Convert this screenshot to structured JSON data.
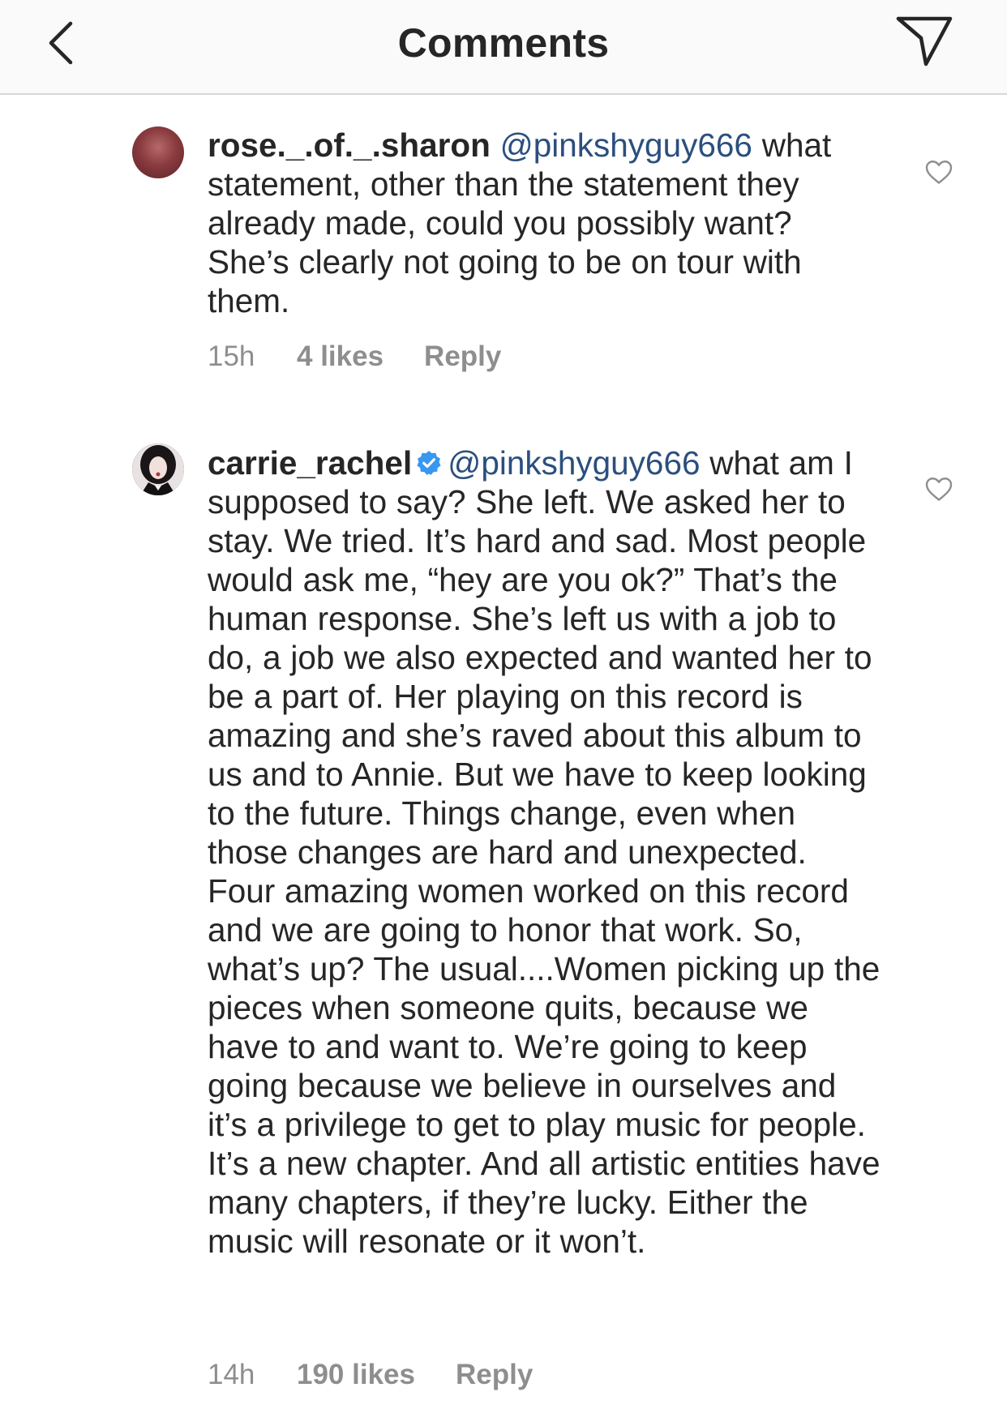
{
  "header": {
    "title": "Comments",
    "back_icon": "chevron-left-icon",
    "send_icon": "send-paper-plane-icon"
  },
  "comments": [
    {
      "username": "rose._.of._.sharon",
      "mention": "@pinkshyguy666",
      "text": " what statement, other than the statement they already made, could you possibly want? She’s clearly not going to be on tour with them.",
      "time": "15h",
      "likes": "4 likes",
      "reply": "Reply",
      "verified": false
    },
    {
      "username": "carrie_rachel",
      "mention": "@pinkshyguy666",
      "text": " what am I supposed to say? She left. We asked her to stay. We tried. It’s hard and sad. Most people would ask me, “hey are you ok?” That’s the human response. She’s left us with a job to do, a job we also expected and wanted her to be a part of. Her playing on this record is amazing and she’s raved about this album to us and to Annie. But we have to keep looking to the future. Things change, even when those changes are hard and unexpected. Four amazing women worked on this record and we are going to honor that work. So, what’s up? The usual....Women picking up the pieces when someone quits, because we have to and want to. We’re going to keep going because we believe in ourselves and it’s a privilege to get to play music for people. It’s a new chapter. And all artistic entities have many chapters, if they’re lucky. Either the music will resonate or it won’t.",
      "time": "14h",
      "likes": "190 likes",
      "reply": "Reply",
      "verified": true
    }
  ],
  "colors": {
    "text": "#262626",
    "mention": "#2b4f7e",
    "meta": "#8e8e8e",
    "verified": "#3897f0",
    "header_bg": "#fafafa"
  }
}
